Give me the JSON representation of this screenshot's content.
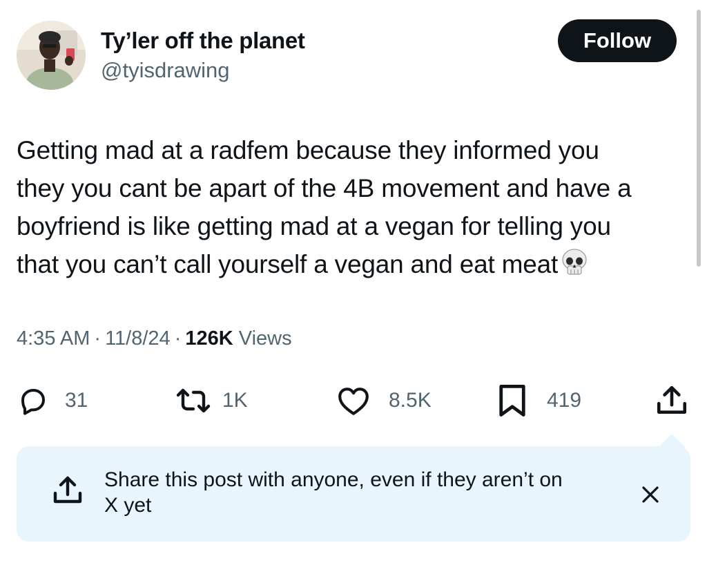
{
  "author": {
    "display_name": "Ty’ler off the planet",
    "handle": "@tyisdrawing"
  },
  "follow_label": "Follow",
  "post": {
    "lines": [
      "Getting mad at a radfem because they informed you",
      "they you cant be apart of the 4B movement and have a",
      "boyfriend is like getting mad at a vegan for telling you",
      "that you can’t call yourself a vegan and eat meat"
    ],
    "emoji": "skull-emoji"
  },
  "meta": {
    "time": "4:35 AM",
    "separator": "·",
    "date": "11/8/24",
    "views_count": "126K",
    "views_label": "Views"
  },
  "actions": {
    "replies": "31",
    "reposts": "1K",
    "likes": "8.5K",
    "bookmarks": "419"
  },
  "share_tooltip": {
    "text_line1": "Share this post with anyone, even if they aren’t on",
    "text_line2": "X yet"
  },
  "icons": [
    "reply-icon",
    "repost-icon",
    "like-icon",
    "bookmark-icon",
    "share-icon",
    "close-icon"
  ],
  "colors": {
    "text": "#0f1419",
    "secondary": "#536471",
    "follow_bg": "#0f1419",
    "tooltip_bg": "#e8f5fd"
  }
}
